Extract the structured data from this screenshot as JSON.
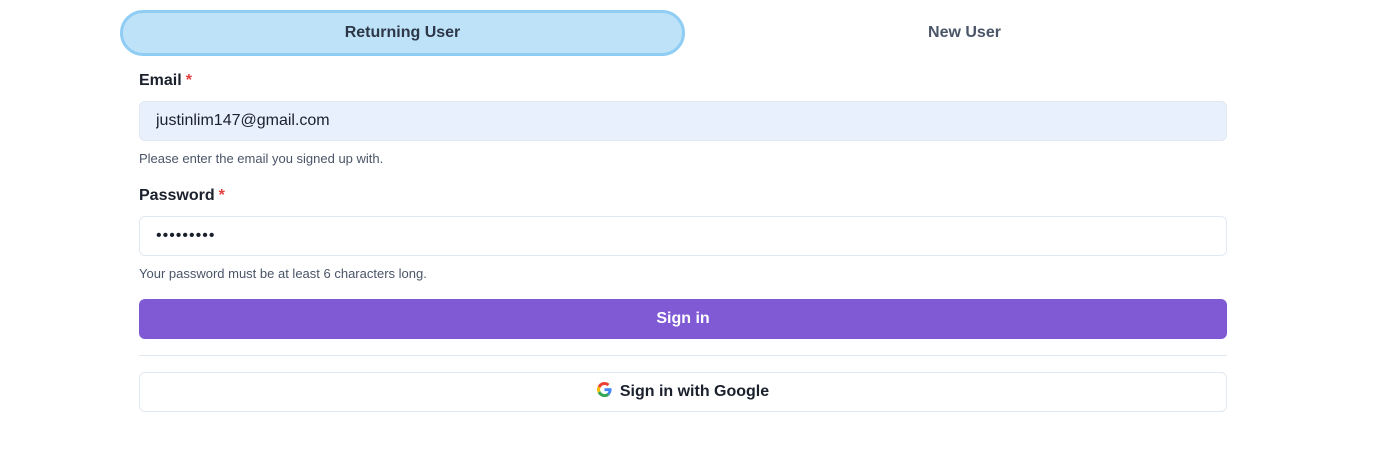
{
  "tabs": {
    "returning_user": "Returning User",
    "new_user": "New User"
  },
  "email": {
    "label": "Email",
    "required_mark": "*",
    "value": "justinlim147@gmail.com",
    "helper": "Please enter the email you signed up with."
  },
  "password": {
    "label": "Password",
    "required_mark": "*",
    "value": "•••••••••",
    "helper": "Your password must be at least 6 characters long."
  },
  "sign_in_button": "Sign in",
  "google_button": {
    "label": "Sign in with Google",
    "icon": "google-icon"
  },
  "colors": {
    "active_tab_bg": "#bee3f8",
    "active_tab_border": "#90cdf4",
    "primary": "#805ad5",
    "required": "#e53e3e",
    "email_autofill_bg": "#e8f0fe"
  }
}
